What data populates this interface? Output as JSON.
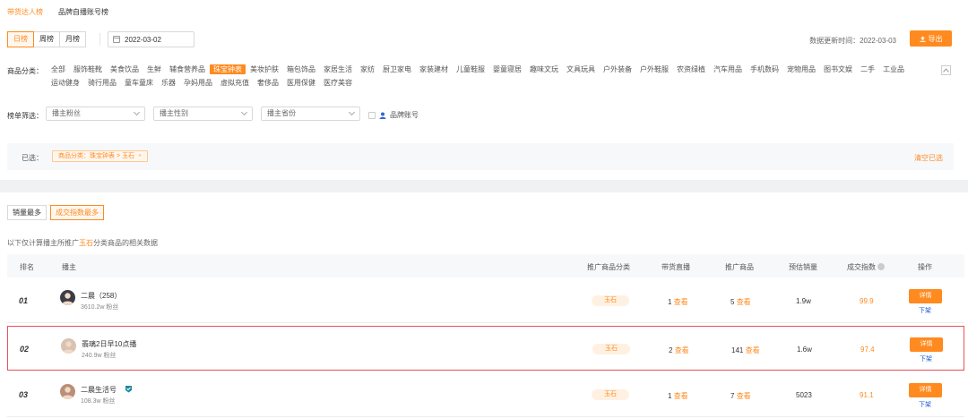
{
  "tabs": [
    "带货达人榜",
    "品牌自播账号榜"
  ],
  "period": [
    "日榜",
    "周榜",
    "月榜"
  ],
  "date": "2022-03-02",
  "update_label": "数据更新时间：",
  "update_date": "2022-03-03",
  "export_label": "导出",
  "category_label": "商品分类：",
  "categories": [
    "全部",
    "服饰鞋靴",
    "美食饮品",
    "生鲜",
    "辅食营养品",
    "珠宝钟表",
    "美妆护肤",
    "箱包饰品",
    "家居生活",
    "家纺",
    "厨卫家电",
    "家装建材",
    "儿童鞋服",
    "婴童寝居",
    "趣味文玩",
    "文具玩具",
    "户外装备",
    "户外鞋服",
    "农资绿植",
    "汽车用品",
    "手机数码",
    "宠物用品",
    "图书文娱",
    "二手",
    "工业品",
    "运动健身",
    "骑行用品",
    "童车童床",
    "乐器",
    "孕妈用品",
    "虚拟充值",
    "奢侈品",
    "医用保健",
    "医疗美容"
  ],
  "active_category": "珠宝钟表",
  "filter_label": "榜单筛选：",
  "filters": [
    "播主粉丝",
    "播主性别",
    "播主省份"
  ],
  "brand_account_label": "品牌账号",
  "selected_label": "已选：",
  "selected_tag": "商品分类：珠宝钟表 > 玉石",
  "selected_tag_close": "×",
  "clear_all": "清空已选",
  "sort_tabs": [
    "销量最多",
    "成交指数最多"
  ],
  "note": {
    "prefix": "以下仅计算播主所推广",
    "highlight": "玉石",
    "suffix": "分类商品的相关数据"
  },
  "columns": [
    "排名",
    "播主",
    "推广商品分类",
    "带货直播",
    "推广商品",
    "预估销量",
    "成交指数",
    "操作"
  ],
  "view_label": "查看",
  "detail_label": "详情",
  "unlist_label": "下架",
  "rows": [
    {
      "rank": "01",
      "name": "二晨（258）",
      "fans": "3610.2w 粉丝",
      "category": "玉石",
      "lives": "1",
      "products": "5",
      "sales": "1.9w",
      "index": "99.9",
      "avatar_color": "#3a3d44"
    },
    {
      "rank": "02",
      "name": "翡璃2日早10点播",
      "fans": "240.9w 粉丝",
      "category": "玉石",
      "lives": "2",
      "products": "141",
      "sales": "1.6w",
      "index": "97.4",
      "avatar_color": "#d9c2b4"
    },
    {
      "rank": "03",
      "name": "二晨生活号",
      "fans": "108.3w 粉丝",
      "category": "玉石",
      "lives": "1",
      "products": "7",
      "sales": "5023",
      "index": "91.1",
      "avatar_color": "#b98f78"
    }
  ],
  "colors": {
    "accent": "#ff8a1f",
    "highlight_border": "#e8505b",
    "link_blue": "#1f5fd6"
  }
}
